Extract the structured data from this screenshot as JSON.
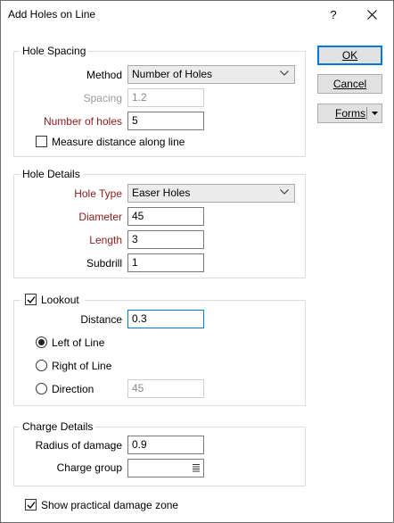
{
  "window": {
    "title": "Add Holes on Line",
    "help": "?"
  },
  "buttons": {
    "ok": "OK",
    "cancel": "Cancel",
    "forms": "Forms"
  },
  "hole_spacing": {
    "title": "Hole Spacing",
    "method_label": "Method",
    "method_value": "Number of Holes",
    "spacing_label": "Spacing",
    "spacing_value": "1.2",
    "num_holes_label": "Number of holes",
    "num_holes_value": "5",
    "measure_label": "Measure distance along line",
    "measure_checked": false
  },
  "hole_details": {
    "title": "Hole Details",
    "hole_type_label": "Hole Type",
    "hole_type_value": "Easer Holes",
    "diameter_label": "Diameter",
    "diameter_value": "45",
    "length_label": "Length",
    "length_value": "3",
    "subdrill_label": "Subdrill",
    "subdrill_value": "1"
  },
  "lookout": {
    "title": "Lookout",
    "checked": true,
    "distance_label": "Distance",
    "distance_value": "0.3",
    "left_label": "Left of Line",
    "right_label": "Right of Line",
    "direction_label": "Direction",
    "direction_value": "45",
    "selected": "left"
  },
  "charge_details": {
    "title": "Charge Details",
    "radius_label": "Radius of damage",
    "radius_value": "0.9",
    "group_label": "Charge group",
    "group_value": ""
  },
  "footer": {
    "show_zone_label": "Show practical damage zone",
    "show_zone_checked": true
  }
}
